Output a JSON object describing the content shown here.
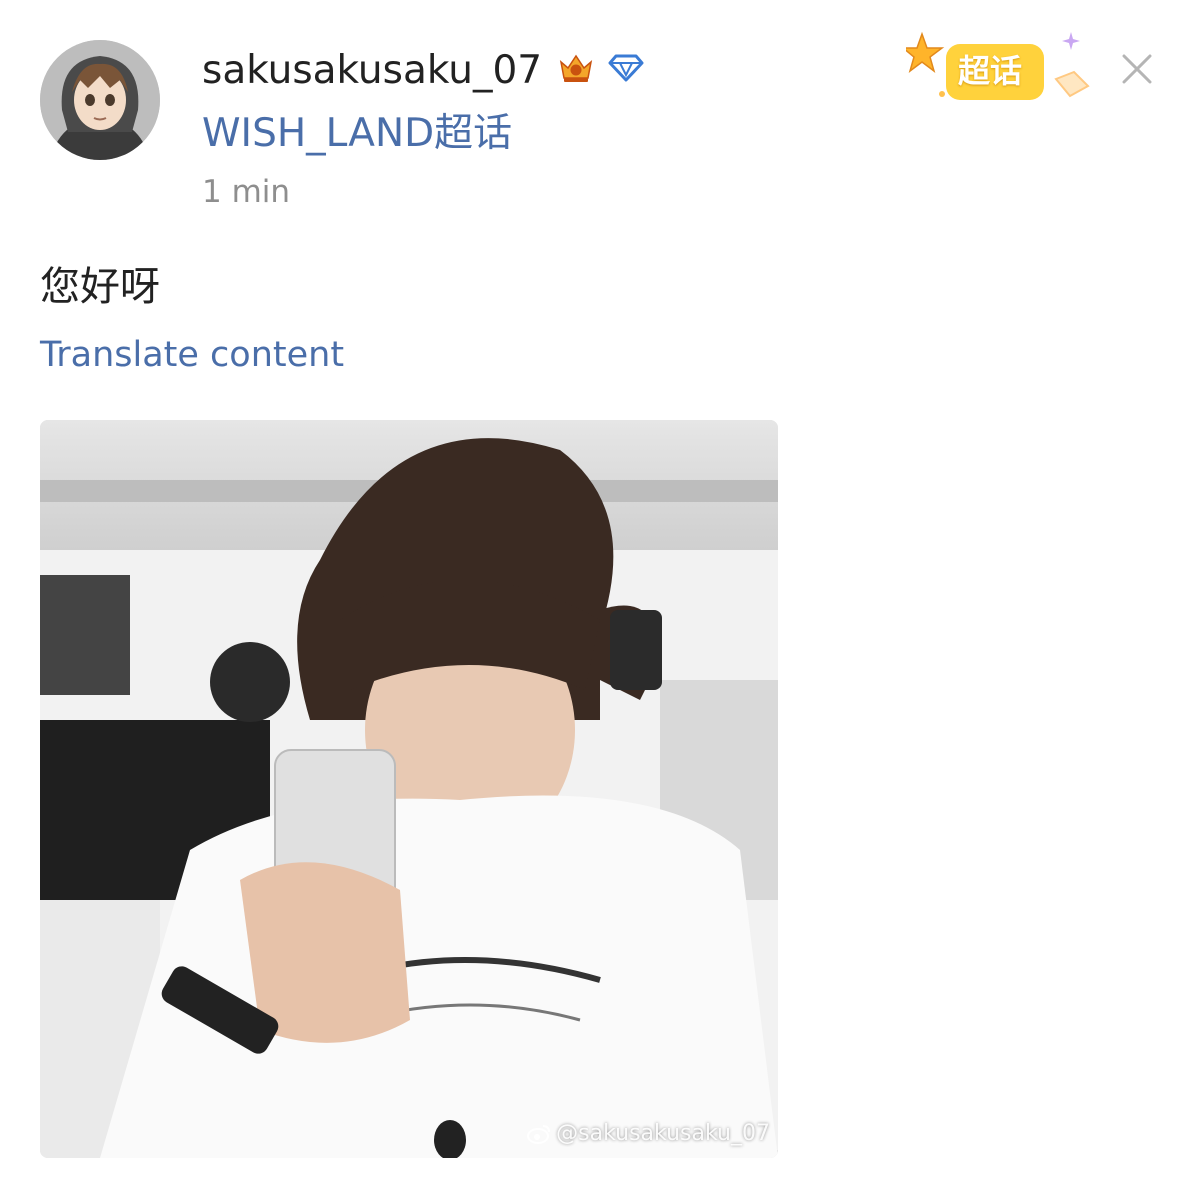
{
  "post": {
    "username": "sakusakusaku_07",
    "topic": "WISH_LAND超话",
    "time": "1 min",
    "text": "您好呀",
    "translate_label": "Translate content",
    "super_topic_badge": "超话",
    "watermark": "@sakusakusaku_07"
  },
  "icons": {
    "crown": "crown-icon",
    "diamond": "diamond-icon",
    "close": "close-icon",
    "weibo": "weibo-icon"
  },
  "colors": {
    "link": "#4a6ea9",
    "badge_yellow": "#ffcc33",
    "diamond_blue": "#3a7bd5"
  }
}
